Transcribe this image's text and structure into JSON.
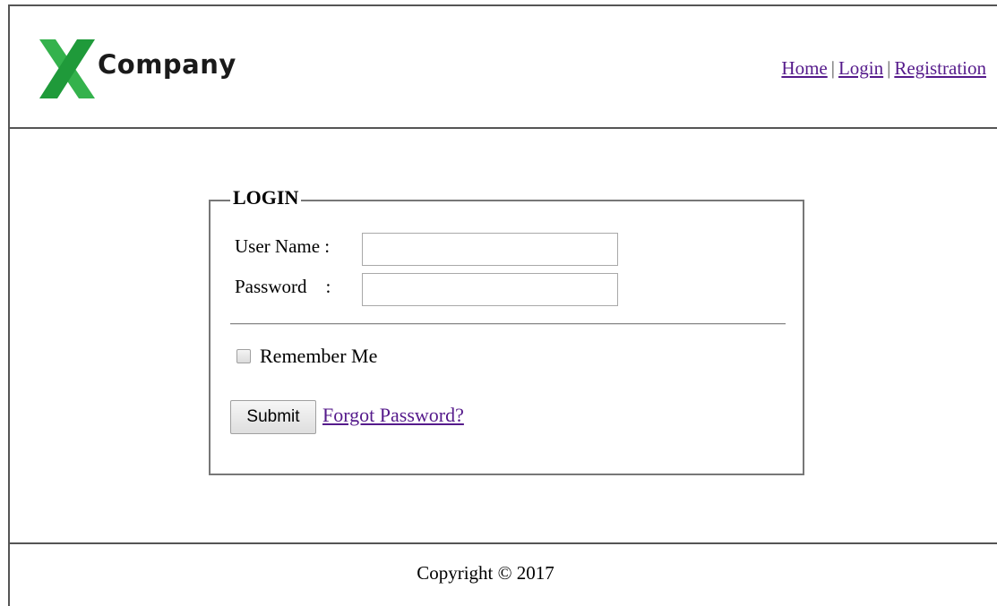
{
  "header": {
    "logo_text": "Company",
    "logo_color": "#2db34a",
    "nav": {
      "home": "Home",
      "login": "Login",
      "registration": "Registration",
      "separator": "|"
    }
  },
  "login_form": {
    "legend": "LOGIN",
    "username_label": "User Name :",
    "username_value": "",
    "password_label": "Password    :",
    "password_value": "",
    "remember_label": "Remember Me",
    "remember_checked": false,
    "submit_label": "Submit",
    "forgot_label": "Forgot Password?"
  },
  "footer": {
    "copyright": "Copyright © 2017"
  },
  "colors": {
    "link_visited": "#551a8b",
    "border": "#555555"
  }
}
